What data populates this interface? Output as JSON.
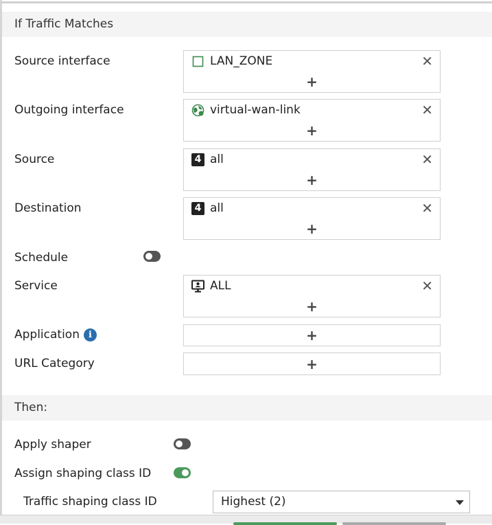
{
  "traffic_section": {
    "title": "If Traffic Matches"
  },
  "rows": {
    "source_interface": {
      "label": "Source interface",
      "entry": "LAN_ZONE",
      "icon": "interface-square-icon"
    },
    "outgoing_interface": {
      "label": "Outgoing interface",
      "entry": "virtual-wan-link",
      "icon": "sdwan-globe-icon"
    },
    "source": {
      "label": "Source",
      "entry": "all",
      "icon": "ipv4-address-icon"
    },
    "destination": {
      "label": "Destination",
      "entry": "all",
      "icon": "ipv4-address-icon"
    },
    "schedule": {
      "label": "Schedule",
      "enabled": false
    },
    "service": {
      "label": "Service",
      "entry": "ALL",
      "icon": "service-monitor-icon"
    },
    "application": {
      "label": "Application",
      "info_icon": "info-icon"
    },
    "url_category": {
      "label": "URL Category"
    }
  },
  "glyphs": {
    "add": "+",
    "remove": "✕",
    "ipv4": "4",
    "info": "i"
  },
  "then_section": {
    "title": "Then:"
  },
  "then_rows": {
    "apply_shaper": {
      "label": "Apply shaper",
      "enabled": false
    },
    "assign_class": {
      "label": "Assign shaping class ID",
      "enabled": true
    },
    "class_id": {
      "label": "Traffic shaping class ID",
      "value": "Highest (2)"
    }
  },
  "colors": {
    "toggle_on": "#4c9a5b",
    "toggle_off": "#555555",
    "info": "#2a6fad",
    "header_bg": "#f4f4f4"
  }
}
